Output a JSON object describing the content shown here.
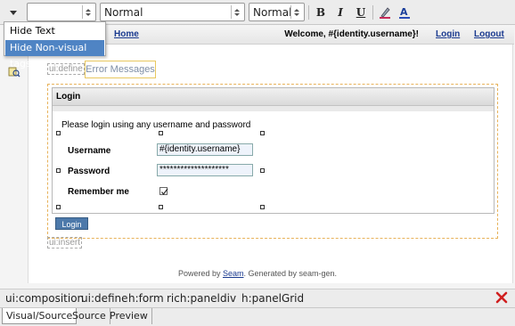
{
  "toolbar": {
    "style_value": "",
    "format_value": "Normal",
    "size_value": "Normal",
    "bold_label": "B",
    "italic_label": "I",
    "underline_label": "U"
  },
  "context_menu": {
    "items": [
      {
        "label": "Hide Text Formatting",
        "selected": false
      },
      {
        "label": "Hide Non-visual tags",
        "selected": true
      }
    ]
  },
  "page": {
    "home_link": "Home",
    "welcome": "Welcome, #{identity.username}!",
    "login_link": "Login",
    "logout_link": "Logout",
    "tag_define": "ui:define",
    "error_messages": "Error Messages",
    "panel_title": "Login",
    "intro": "Please login using any username and password",
    "username_label": "Username",
    "username_value": "#{identity.username}",
    "password_label": "Password",
    "password_value": "********************",
    "remember_label": "Remember me",
    "remember_checked": true,
    "login_button": "Login",
    "tag_insert": "ui:insert",
    "footer_prefix": "Powered by ",
    "footer_link": "Seam",
    "footer_suffix": ". Generated by seam-gen."
  },
  "breadcrumb": [
    "ui:composition",
    "ui:define",
    "h:form",
    "rich:panel",
    "div",
    "h:panelGrid"
  ],
  "tabs": [
    {
      "label": "Visual/Source",
      "active": true
    },
    {
      "label": "Source",
      "active": false
    },
    {
      "label": "Preview",
      "active": false
    }
  ],
  "colors": {
    "menu_selected": "#4f84c4",
    "link": "#1a3a8f",
    "login_button": "#4d79aa",
    "close_icon": "#d02020"
  }
}
